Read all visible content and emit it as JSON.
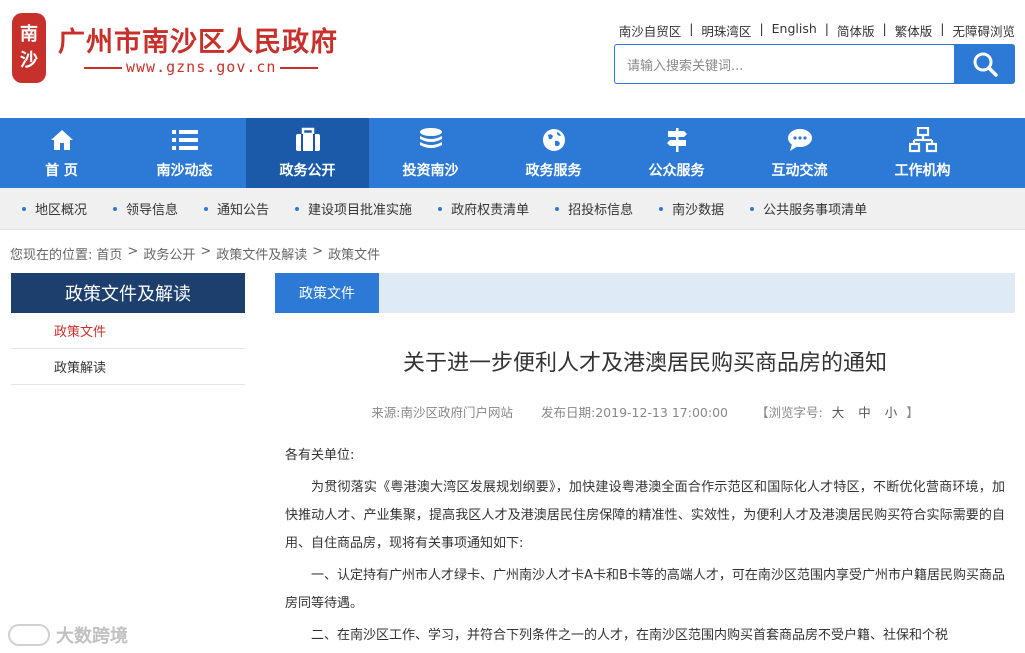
{
  "header": {
    "seal_chars": [
      "南",
      "沙"
    ],
    "site_title": "广州市南沙区人民政府",
    "site_url": "www.gzns.gov.cn",
    "top_links": [
      "南沙自贸区",
      "明珠湾区",
      "English",
      "简体版",
      "繁体版",
      "无障碍浏览"
    ],
    "search_placeholder": "请输入搜索关键词...",
    "colors": {
      "brand_red": "#c7302b",
      "nav_blue": "#2d7ad6",
      "nav_active": "#1a5aa8",
      "side_dark": "#1d3f6e"
    }
  },
  "main_nav": [
    {
      "label": "首 页",
      "icon": "home-icon"
    },
    {
      "label": "南沙动态",
      "icon": "list-icon"
    },
    {
      "label": "政务公开",
      "icon": "briefcase-icon",
      "active": true
    },
    {
      "label": "投资南沙",
      "icon": "coins-icon"
    },
    {
      "label": "政务服务",
      "icon": "globe-icon"
    },
    {
      "label": "公众服务",
      "icon": "signpost-icon"
    },
    {
      "label": "互动交流",
      "icon": "chat-icon"
    },
    {
      "label": "工作机构",
      "icon": "org-chart-icon"
    }
  ],
  "sub_nav": [
    "地区概况",
    "领导信息",
    "通知公告",
    "建设项目批准实施",
    "政府权责清单",
    "招投标信息",
    "南沙数据",
    "公共服务事项清单"
  ],
  "breadcrumb": {
    "prefix": "您现在的位置:",
    "items": [
      "首页",
      "政务公开",
      "政策文件及解读",
      "政策文件"
    ]
  },
  "sidebar": {
    "title": "政策文件及解读",
    "items": [
      "政策文件",
      "政策解读"
    ]
  },
  "content": {
    "tab_label": "政策文件",
    "title": "关于进一步便利人才及港澳居民购买商品房的通知",
    "meta": {
      "source": "来源:南沙区政府门户网站",
      "date": "发布日期:2019-12-13 17:00:00",
      "font_label": "【浏览字号:",
      "font_large": "大",
      "font_medium": "中",
      "font_small": "小",
      "font_end": "】"
    },
    "paragraphs": [
      "各有关单位:",
      "为贯彻落实《粤港澳大湾区发展规划纲要》，加快建设粤港澳全面合作示范区和国际化人才特区，不断优化营商环境，加快推动人才、产业集聚，提高我区人才及港澳居民住房保障的精准性、实效性，为便利人才及港澳居民购买符合实际需要的自用、自住商品房，现将有关事项通知如下:",
      "一、认定持有广州市人才绿卡、广州南沙人才卡A卡和B卡等的高端人才，可在南沙区范围内享受广州市户籍居民购买商品房同等待遇。",
      "二、在南沙区工作、学习，并符合下列条件之一的人才，在南沙区范围内购买首套商品房不受户籍、社保和个税"
    ]
  },
  "watermark": "大数跨境"
}
